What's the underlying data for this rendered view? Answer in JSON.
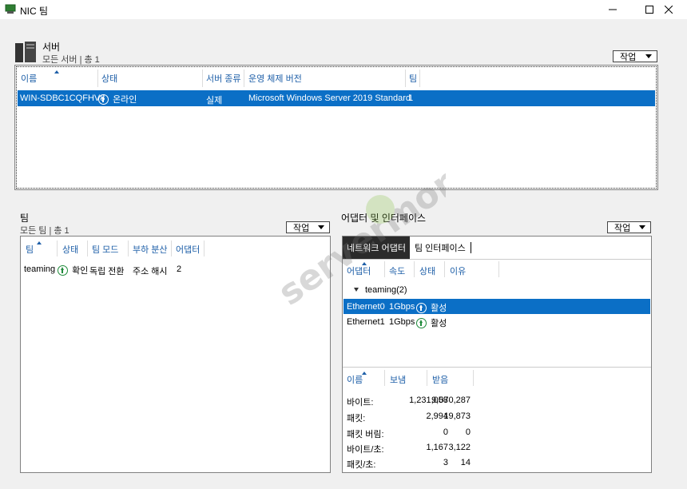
{
  "window": {
    "title": "NIC 팀"
  },
  "servers": {
    "title": "서버",
    "subtitle": "모든 서버 | 총 1",
    "action_label": "작업",
    "columns": [
      "이름",
      "상태",
      "서버 종류",
      "운영 체제 버전",
      "팀"
    ],
    "rows": [
      {
        "name": "WIN-SDBC1CQFHV8",
        "status": "온라인",
        "type": "실제",
        "os": "Microsoft Windows Server 2019 Standard",
        "team": "1"
      }
    ]
  },
  "teams": {
    "title": "팀",
    "subtitle": "모든 팀 | 총 1",
    "action_label": "작업",
    "columns": [
      "팀",
      "상태",
      "팀 모드",
      "부하 분산",
      "어댑터"
    ],
    "rows": [
      {
        "team": "teaming",
        "status": "확인",
        "mode": "독립 전환",
        "lb": "주소 해시",
        "adapters": "2"
      }
    ]
  },
  "adapters": {
    "title": "어댑터 및 인터페이스",
    "action_label": "작업",
    "tabs": [
      "네트워크 어댑터",
      "팀 인터페이스"
    ],
    "columns": [
      "어댑터",
      "속도",
      "상태",
      "이유"
    ],
    "group_label": "teaming(2)",
    "rows": [
      {
        "name": "Ethernet0",
        "speed": "1Gbps",
        "status": "활성"
      },
      {
        "name": "Ethernet1",
        "speed": "1Gbps",
        "status": "활성"
      }
    ],
    "stats_columns": [
      "이름",
      "보냄",
      "받음"
    ],
    "stats": [
      {
        "label": "바이트:",
        "sent": "1,231,058",
        "recv": "9,070,287"
      },
      {
        "label": "패킷:",
        "sent": "2,994",
        "recv": "19,873"
      },
      {
        "label": "패킷 버림:",
        "sent": "0",
        "recv": "0"
      },
      {
        "label": "바이트/초:",
        "sent": "1,167",
        "recv": "3,122"
      },
      {
        "label": "패킷/초:",
        "sent": "3",
        "recv": "14"
      }
    ]
  },
  "watermark": {
    "text": "servermon"
  },
  "colors": {
    "selection": "#0b6fc6",
    "header_text": "#1e5fa8",
    "status_ok": "#1e8a3a"
  }
}
